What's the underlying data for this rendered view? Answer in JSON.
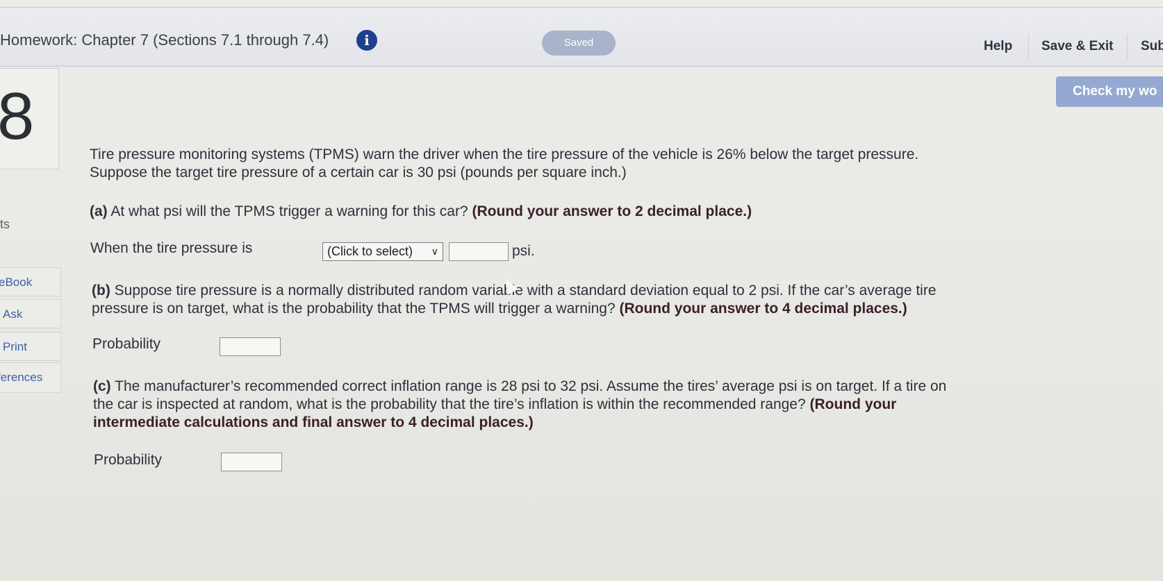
{
  "header": {
    "title": "Homework: Chapter 7 (Sections 7.1 through 7.4)",
    "status": "Saved",
    "links": {
      "help": "Help",
      "save_exit": "Save & Exit",
      "submit": "Sub"
    }
  },
  "sidebar": {
    "question_number": "8",
    "points_label": "ts",
    "tools": [
      "eBook",
      "Ask",
      "Print",
      "ferences"
    ]
  },
  "check_button": "Check my wo",
  "question": {
    "intro_line1": "Tire pressure monitoring systems (TPMS) warn the driver when the tire pressure of the vehicle is 26% below the target pressure.",
    "intro_line2": "Suppose the target tire pressure of a certain car is 30 psi (pounds per square inch.)",
    "part_a": {
      "label": "(a)",
      "text": " At what psi will the TPMS trigger a warning for this car? ",
      "instruction": "(Round your answer to 2 decimal place.)",
      "answer_prefix": "When the tire pressure is",
      "select_value": "(Click to select)",
      "select_chevron": "∨",
      "unit": "psi."
    },
    "part_b": {
      "label": "(b)",
      "line1": " Suppose tire pressure is a normally distributed random variable with a standard deviation equal to 2 psi. If the car’s average tire",
      "line2": "pressure is on target, what is the probability that the TPMS will trigger a warning? ",
      "instruction": "(Round your answer to 4 decimal places.)",
      "answer_label": "Probability"
    },
    "part_c": {
      "label": "(c)",
      "line1": " The manufacturer’s recommended correct inflation range is 28 psi to 32 psi. Assume the tires’ average psi is on target. If a tire on",
      "line2": "the car is inspected at random, what is the probability that the tire’s inflation is within the recommended range? ",
      "instruction_part1": "(Round your",
      "instruction_line3": "intermediate calculations and final answer to 4 decimal places.)",
      "answer_label": "Probability"
    }
  },
  "colors": {
    "info_icon": "#1f3f8f",
    "saved_pill": "#a9b3ca",
    "check_button": "#94a8d2",
    "link_blue": "#3c5fa8"
  }
}
